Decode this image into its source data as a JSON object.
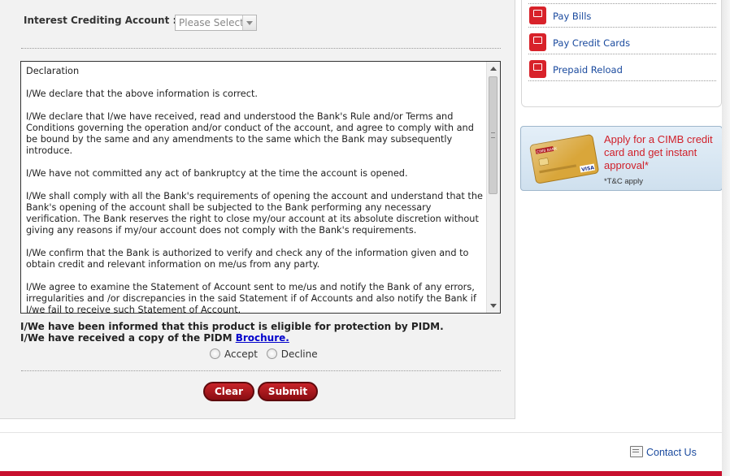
{
  "form": {
    "crediting_label": "Interest Crediting Account :",
    "crediting_select_value": "Please Select",
    "declaration_paragraphs": [
      "Declaration",
      "I/We declare that the above information is correct.",
      "I/We declare that I/we have received, read and understood the Bank's Rule and/or Terms and Conditions governing the operation and/or conduct of the account, and agree to comply with and be bound by the same and any amendments to the same which the Bank may subsequently introduce.",
      "I/We have not committed any act of bankruptcy at the time the account is opened.",
      "I/We shall comply with all the Bank's requirements of opening the account and understand that the Bank's opening of the account shall be subjected to the Bank performing any necessary verification. The Bank reserves the right to close my/our account at its absolute discretion without giving any reasons if my/our account does not comply with the Bank's requirements.",
      "I/We confirm that the Bank is authorized to verify and check any of the information given and to obtain credit and relevant information on me/us from any party.",
      "I/We agree to examine the Statement of Account sent to me/us and notify the Bank of any errors, irregularities and /or discrepancies in the said Statement if of Accounts and also notify the Bank if I/we fail to receive such Statement of Account."
    ],
    "pidm_line1": "I/We have been informed that this product is eligible for protection by PIDM.",
    "pidm_line2_prefix": "I/We have received a copy of the PIDM ",
    "brochure_link": "Brochure.",
    "accept_label": "Accept",
    "decline_label": "Decline",
    "clear_label": "Clear",
    "submit_label": "Submit"
  },
  "quick_links": [
    {
      "label": "Pay Bills",
      "icon": "bill-icon"
    },
    {
      "label": "Pay Credit Cards",
      "icon": "credit-card-icon"
    },
    {
      "label": "Prepaid Reload",
      "icon": "reload-icon"
    }
  ],
  "banner": {
    "headline": "Apply for a CIMB credit card and get instant approval*",
    "tnc": "*T&C apply",
    "card_brand": "CIMB BANK",
    "card_network": "VISA"
  },
  "footer": {
    "contact_label": "Contact Us"
  },
  "colors": {
    "accent_red": "#c8102e",
    "link_blue": "#1a4a9e"
  }
}
